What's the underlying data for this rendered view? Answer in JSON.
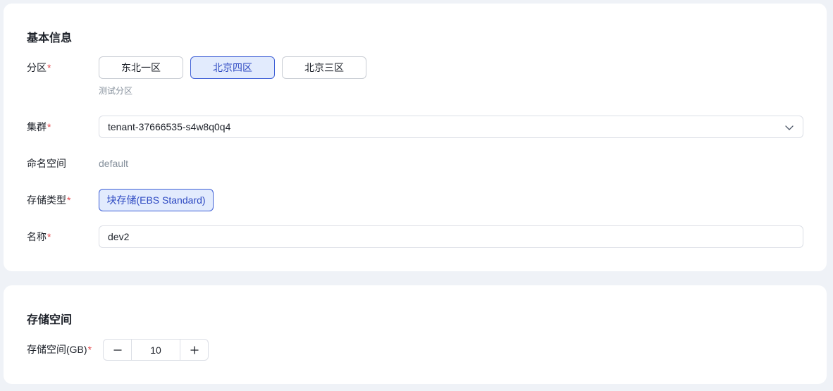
{
  "basic_info": {
    "title": "基本信息",
    "zone": {
      "label": "分区",
      "required_mark": "*",
      "options": [
        "东北一区",
        "北京四区",
        "北京三区"
      ],
      "selected": "北京四区",
      "hint": "测试分区"
    },
    "cluster": {
      "label": "集群",
      "required_mark": "*",
      "value": "tenant-37666535-s4w8q0q4",
      "icon": "chevron-down-icon"
    },
    "namespace": {
      "label": "命名空间",
      "value": "default"
    },
    "storage_type": {
      "label": "存储类型",
      "required_mark": "*",
      "options": [
        "块存储(EBS Standard)"
      ],
      "selected": "块存储(EBS Standard)"
    },
    "name": {
      "label": "名称",
      "required_mark": "*",
      "value": "dev2"
    }
  },
  "storage": {
    "title": "存储空间",
    "capacity": {
      "label": "存储空间(GB)",
      "required_mark": "*",
      "value": "10",
      "minus_icon": "minus-icon",
      "plus_icon": "plus-icon"
    }
  },
  "colors": {
    "page_bg": "#eff2f7",
    "card_bg": "#ffffff",
    "accent": "#3e5fd6",
    "accent_bg": "#e2ebfd",
    "required": "#e5484d",
    "muted_text": "#86909c"
  }
}
